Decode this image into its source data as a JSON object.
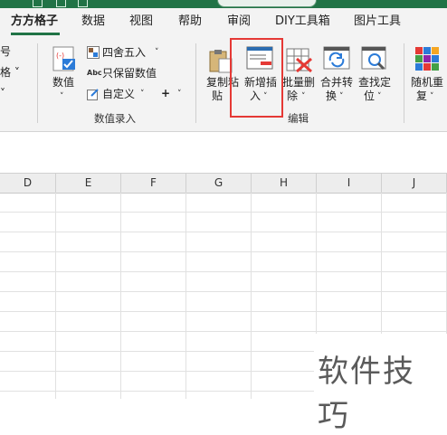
{
  "tabs": [
    "方方格子",
    "数据",
    "视图",
    "帮助",
    "审阅",
    "DIY工具箱",
    "图片工具"
  ],
  "ribbon": {
    "left_clipped": [
      "号",
      "格",
      "格 ˅",
      "˅"
    ],
    "numeric": {
      "value_label": "数值",
      "round_label": "四舍五入",
      "keep_values_label": "只保留数值",
      "custom_label": "自定义",
      "plus": "+",
      "group_label": "数值录入"
    },
    "edit": {
      "copy_paste": [
        "复制粘",
        "贴"
      ],
      "insert_new": [
        "新增插",
        "入"
      ],
      "batch_delete": [
        "批量删",
        "除"
      ],
      "merge_convert": [
        "合并转",
        "换"
      ],
      "find_locate": [
        "查找定",
        "位"
      ],
      "random_repeat": [
        "随机重",
        "复"
      ],
      "group_label": "编辑"
    },
    "highlight_color": "#e53935"
  },
  "sheet": {
    "columns": [
      "D",
      "E",
      "F",
      "G",
      "H",
      "I",
      "J"
    ]
  },
  "watermark": "软件技巧",
  "colors": {
    "brand": "#217346",
    "ribbon_bg": "#f3f3f3",
    "grid": "#e1e1e1"
  }
}
